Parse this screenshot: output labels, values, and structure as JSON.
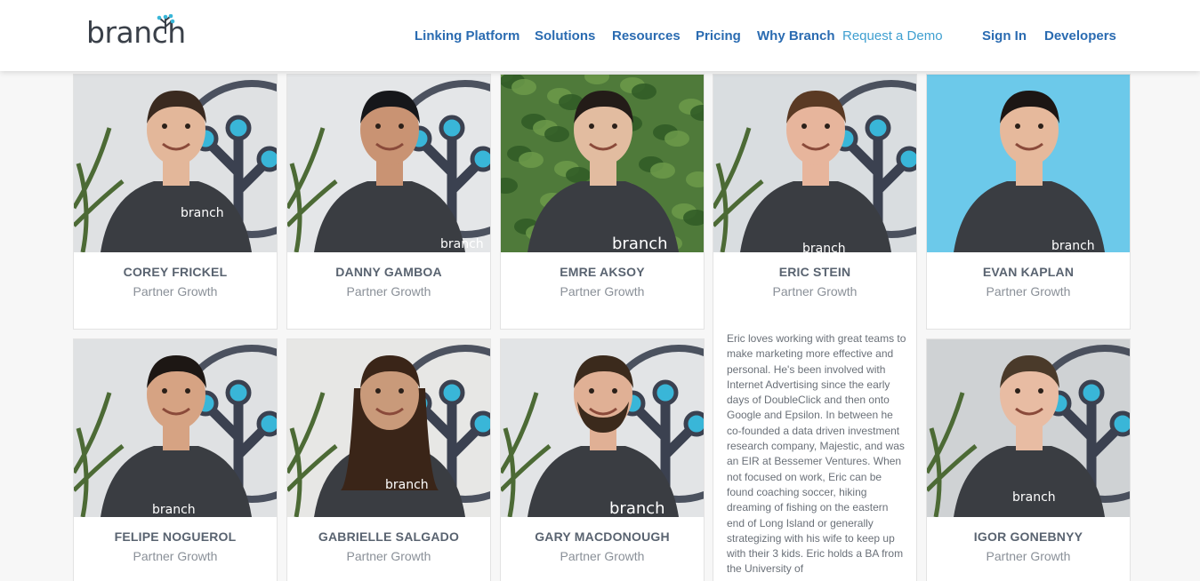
{
  "header": {
    "logo_text": "branch",
    "nav": [
      {
        "label": "Linking Platform",
        "name": "nav-linking-platform"
      },
      {
        "label": "Solutions",
        "name": "nav-solutions"
      },
      {
        "label": "Resources",
        "name": "nav-resources"
      },
      {
        "label": "Pricing",
        "name": "nav-pricing"
      },
      {
        "label": "Why Branch",
        "name": "nav-why-branch"
      },
      {
        "label": "Request a Demo",
        "name": "nav-request-demo"
      },
      {
        "label": "Sign In",
        "name": "nav-sign-in"
      },
      {
        "label": "Developers",
        "name": "nav-developers"
      }
    ]
  },
  "team": [
    {
      "name": "COREY FRICKEL",
      "role": "Partner Growth",
      "shirt_text": "branch"
    },
    {
      "name": "DANNY GAMBOA",
      "role": "Partner Growth",
      "shirt_text": "branch"
    },
    {
      "name": "EMRE AKSOY",
      "role": "Partner Growth",
      "shirt_text": "branch"
    },
    {
      "name": "ERIC STEIN",
      "role": "Partner Growth",
      "shirt_text": "branch",
      "bio": "Eric loves working with great teams to make marketing more effective and personal. He's been involved with Internet Advertising since the early days of DoubleClick and then onto Google and Epsilon. In between he co-founded a data driven investment research company, Majestic, and was an EIR at Bessemer Ventures. When not focused on work, Eric can be found coaching soccer, hiking dreaming of fishing on the eastern end of Long Island or generally strategizing with his wife to keep up with their 3 kids. Eric holds a BA from the University of"
    },
    {
      "name": "EVAN KAPLAN",
      "role": "Partner Growth",
      "shirt_text": "branch"
    },
    {
      "name": "FELIPE NOGUEROL",
      "role": "Partner Growth",
      "shirt_text": "branch"
    },
    {
      "name": "GABRIELLE SALGADO",
      "role": "Partner Growth",
      "shirt_text": "branch"
    },
    {
      "name": "GARY MACDONOUGH",
      "role": "Partner Growth",
      "shirt_text": "branch"
    },
    {
      "name": "IGOR GONEBNYY",
      "role": "Partner Growth",
      "shirt_text": "branch"
    }
  ],
  "colors": {
    "brand_blue": "#2a6bb1",
    "demo_link": "#3f9fd0",
    "tree_dot": "#39b6d8",
    "tree_dark": "#3b4150",
    "shirt": "#3a3d42"
  }
}
